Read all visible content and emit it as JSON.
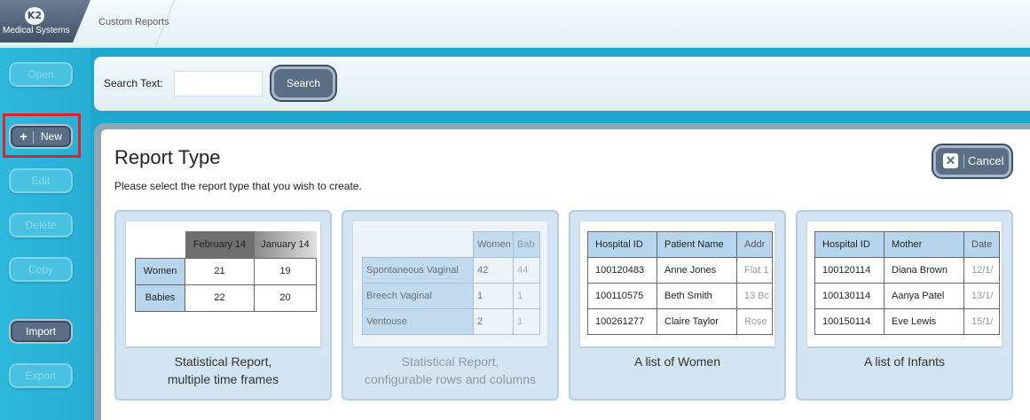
{
  "header": {
    "logo_text": "Medical Systems",
    "logo_mark": "K2",
    "breadcrumb": "Custom Reports"
  },
  "sidebar": {
    "open": "Open",
    "new": "New",
    "edit": "Edit",
    "delete": "Delete",
    "copy": "Copy",
    "import": "Import",
    "export": "Export"
  },
  "search": {
    "label": "Search Text:",
    "value": "",
    "button": "Search"
  },
  "dialog": {
    "title": "Report Type",
    "subtitle": "Please select the report type that you wish to create.",
    "cancel": "Cancel"
  },
  "cards": [
    {
      "caption_line1": "Statistical Report,",
      "caption_line2": "multiple time frames",
      "headers": [
        "February 14",
        "January 14"
      ],
      "rows": [
        {
          "label": "Women",
          "values": [
            "21",
            "19"
          ]
        },
        {
          "label": "Babies",
          "values": [
            "22",
            "20"
          ]
        }
      ]
    },
    {
      "caption_line1": "Statistical Report,",
      "caption_line2": "configurable rows and columns",
      "headers": [
        "Women",
        "Bab"
      ],
      "rows": [
        {
          "label": "Spontaneous Vaginal",
          "values": [
            "42",
            "44"
          ]
        },
        {
          "label": "Breech Vaginal",
          "values": [
            "1",
            "1"
          ]
        },
        {
          "label": "Ventouse",
          "values": [
            "2",
            "1"
          ]
        }
      ]
    },
    {
      "caption_line1": "A list of Women",
      "headers": [
        "Hospital ID",
        "Patient Name",
        "Addr"
      ],
      "rows": [
        [
          "100120483",
          "Anne Jones",
          "Flat 1"
        ],
        [
          "100110575",
          "Beth Smith",
          "13 Bc"
        ],
        [
          "100261277",
          "Claire Taylor",
          "Rose"
        ]
      ]
    },
    {
      "caption_line1": "A list of Infants",
      "headers": [
        "Hospital ID",
        "Mother",
        "Date"
      ],
      "rows": [
        [
          "100120114",
          "Diana Brown",
          "12/1/"
        ],
        [
          "100130114",
          "Aanya Patel",
          "13/1/"
        ],
        [
          "100150114",
          "Eve Lewis",
          "15/1/"
        ]
      ]
    }
  ]
}
